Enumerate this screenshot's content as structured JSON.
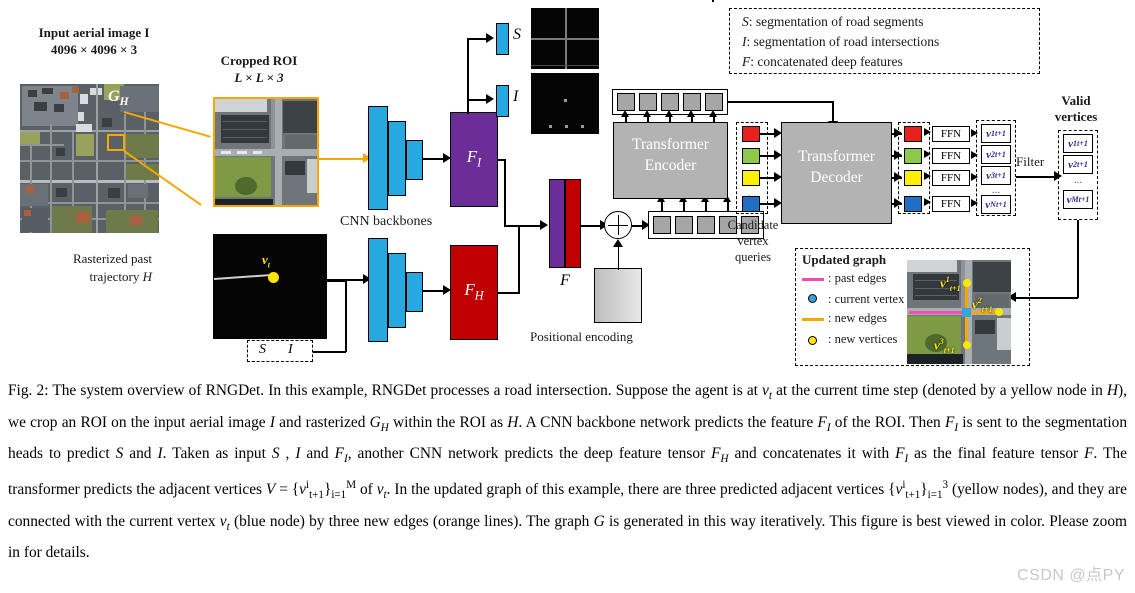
{
  "figure": {
    "left_panel": {
      "input_image_title_line1": "Input aerial image I",
      "input_image_title_line2": "4096 × 4096 × 3",
      "graph_overlay_label": "G",
      "graph_overlay_sub": "H",
      "cropped_roi_line1": "Cropped ROI",
      "cropped_roi_line2": "L × L × 3",
      "trajectory_line1": "Rasterized past",
      "trajectory_line2": "trajectory",
      "trajectory_symbol": "H",
      "vt_label": "v",
      "vt_sub": "t",
      "si_dashed_s": "S",
      "si_dashed_i": "I"
    },
    "backbone": {
      "cnn_label": "CNN backbones",
      "feature_I": "F",
      "feature_I_sub": "I",
      "feature_H": "F",
      "feature_H_sub": "H",
      "seg_s_label": "S",
      "seg_i_label": "I",
      "concat_feature": "F",
      "positional_encoding": "Positional encoding"
    },
    "transformer": {
      "encoder_line1": "Transformer",
      "encoder_line2": "Encoder",
      "decoder_line1": "Transformer",
      "decoder_line2": "Decoder",
      "candidate_queries_line1": "Candidate",
      "candidate_queries_line2": "vertex",
      "candidate_queries_line3": "queries",
      "query_colors": [
        "#e8211a",
        "#8ec94a",
        "#ffef00",
        "#1f6fc4"
      ],
      "ellipsis": "..."
    },
    "heads": {
      "ffn_label": "FFN",
      "ffn_count": 4,
      "predicted_vertices": [
        "v1",
        "v2",
        "v3",
        "vN"
      ],
      "predicted_vertex_supers": [
        "1",
        "2",
        "3",
        "N"
      ],
      "predicted_vertex_base": "v",
      "predicted_vertex_sub": "t+1",
      "filter_label": "Filter",
      "valid_vertices_line1": "Valid",
      "valid_vertices_line2": "vertices",
      "valid_vertex_supers": [
        "1",
        "2",
        "M"
      ],
      "ellipsis": "..."
    },
    "notation_legend": {
      "items": [
        {
          "symbol": "S",
          "text": ": segmentation of road segments"
        },
        {
          "symbol": "I",
          "text": ": segmentation of road intersections"
        },
        {
          "symbol": "F",
          "text": ": concatenated deep features"
        }
      ]
    },
    "updated_graph": {
      "title": "Updated graph",
      "legend": [
        {
          "glyph": "line",
          "color": "#f24fb0",
          "text": ": past edges"
        },
        {
          "glyph": "dot",
          "color": "#33a5d8",
          "text": ": current vertex"
        },
        {
          "glyph": "line",
          "color": "#f5a800",
          "text": ": new edges"
        },
        {
          "glyph": "dot",
          "color": "#ffe600",
          "text": ": new vertices"
        }
      ],
      "vertex_labels": [
        {
          "base": "v",
          "sup": "1",
          "sub": "t+1"
        },
        {
          "base": "v",
          "sup": "2",
          "sub": "t+1"
        },
        {
          "base": "v",
          "sup": "3",
          "sub": "t+1"
        }
      ]
    },
    "colors": {
      "accent_yellow": "#f5a800",
      "cnn_blue": "#28a8e0",
      "feature_purple": "#6b2d98",
      "feature_red": "#c00000",
      "transformer_gray": "#b3b3b3",
      "past_edge_pink": "#f24fb0",
      "current_vertex_blue": "#33a5d8",
      "new_vertex_yellow": "#ffe600"
    }
  },
  "caption": {
    "label": "Fig. 2:",
    "text_part1": " The system overview of RNGDet. In this example, RNGDet processes a road intersection. Suppose the agent is at ",
    "v_t": "v",
    "v_t_sub": "t",
    "text_part2": " at the current time step (denoted by a yellow node in ",
    "H1": "H",
    "text_part3": "), we crop an ROI on the input aerial image ",
    "I1": "I",
    "text_part4": " and rasterized ",
    "G": "G",
    "G_sub": "H",
    "text_part5": " within the ROI as ",
    "H2": "H",
    "text_part6": ". A CNN backbone network predicts the feature ",
    "FI1": "F",
    "FI1_sub": "I",
    "text_part7": " of the ROI. Then ",
    "FI2": "F",
    "FI2_sub": "I",
    "text_part8": " is sent to the segmentation heads to predict ",
    "S1": "S",
    "text_part9": " and ",
    "I2": "I",
    "text_part10": ". Taken as input ",
    "S2": "S",
    "text_part11": " , ",
    "I3": "I",
    "text_part12": " and ",
    "FI3": "F",
    "FI3_sub": "I",
    "text_part13": ", another CNN network predicts the deep feature tensor ",
    "FH": "F",
    "FH_sub": "H",
    "text_part14": " and concatenates it with ",
    "FI4": "F",
    "FI4_sub": "I",
    "text_part15": " as the final feature tensor ",
    "F1": "F",
    "text_part16": ". The transformer predicts the adjacent vertices ",
    "V": "V",
    "eq": " = ",
    "set1_open": "{",
    "set1_v": "v",
    "set1_sup": "i",
    "set1_sub": "t+1",
    "set1_close": "}",
    "set1_botsub": "i=1",
    "set1_topsup": "M",
    "text_part17": " of ",
    "vt2": "v",
    "vt2_sub": "t",
    "text_part18": ". In the updated graph of this example, there are three predicted adjacent vertices ",
    "set2_open": "{",
    "set2_v": "v",
    "set2_sup": "i",
    "set2_sub": "t+1",
    "set2_close": "}",
    "set2_botsub": "i=1",
    "set2_topsup": "3",
    "text_part19": " (yellow nodes), and they are connected with the current vertex ",
    "vt3": "v",
    "vt3_sub": "t",
    "text_part20": " (blue node) by three new edges (orange lines). The graph ",
    "Gg": "G",
    "text_part21": " is generated in this way iteratively. This figure is best viewed in color. Please zoom in for details."
  },
  "watermark": {
    "text": "CSDN @点PY"
  }
}
